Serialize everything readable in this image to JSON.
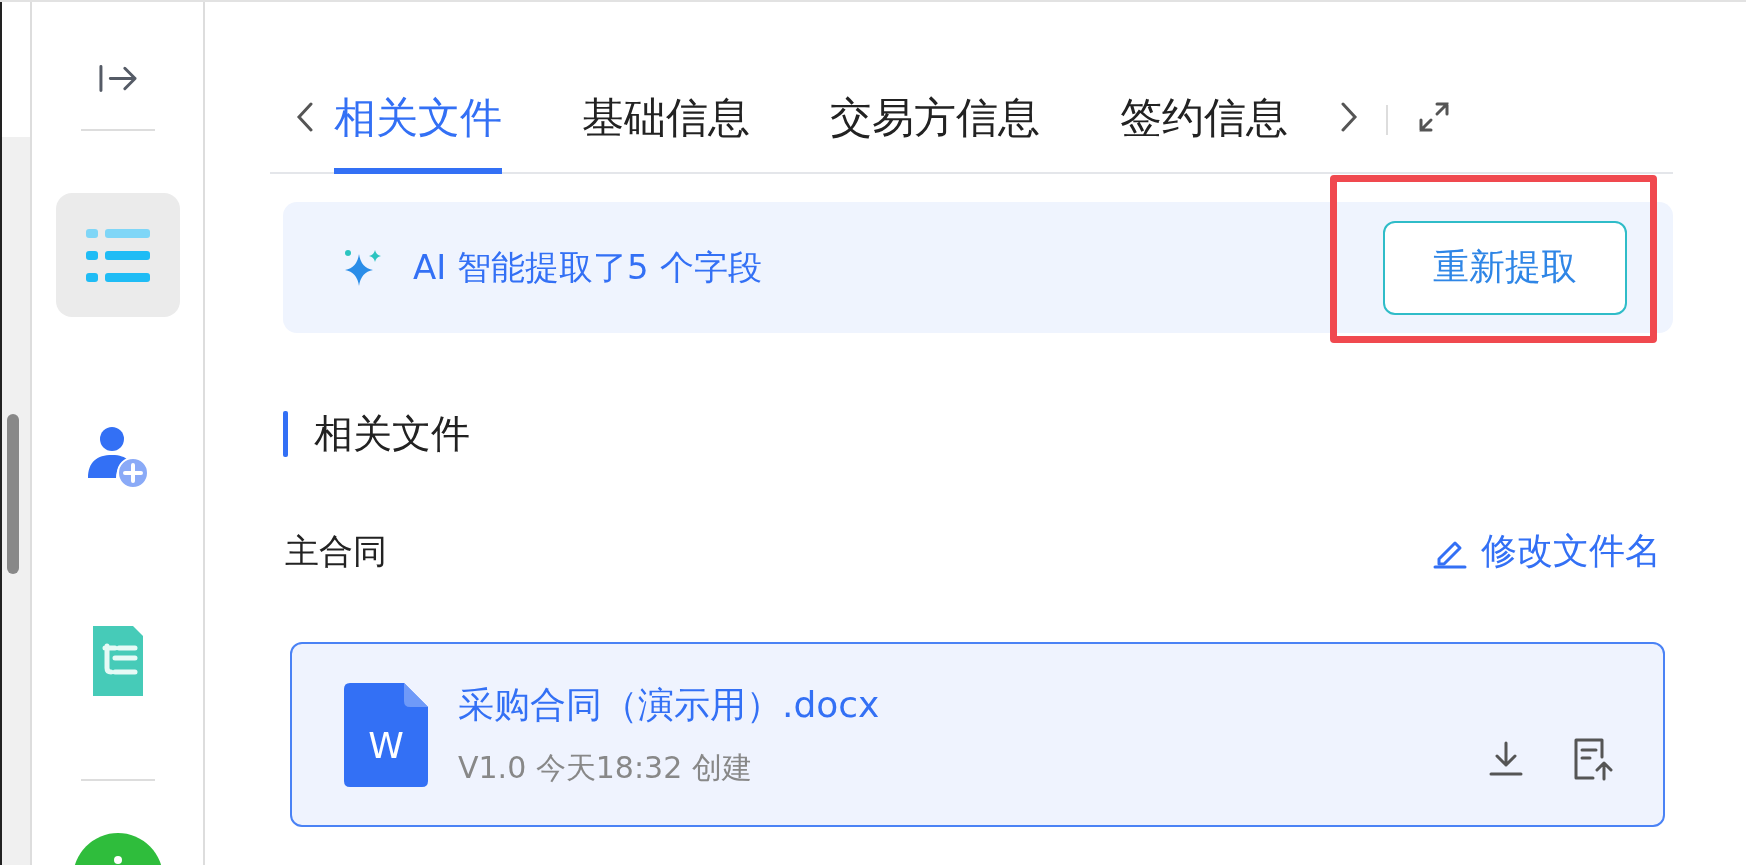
{
  "sidebar": {
    "items": [
      {
        "selected": true
      },
      {
        "selected": false
      },
      {
        "selected": false
      }
    ]
  },
  "tabs": [
    {
      "label": "相关文件",
      "selected": true
    },
    {
      "label": "基础信息",
      "selected": false
    },
    {
      "label": "交易方信息",
      "selected": false
    },
    {
      "label": "签约信息",
      "selected": false
    }
  ],
  "banner": {
    "text": "AI 智能提取了5 个字段",
    "button": "重新提取",
    "highlighted": true
  },
  "section": {
    "title": "相关文件",
    "group": "主合同",
    "rename_link": "修改文件名",
    "file": {
      "name": "采购合同（演示用）.docx",
      "meta": "V1.0 今天18:32 创建",
      "icon_letter": "W"
    }
  }
}
